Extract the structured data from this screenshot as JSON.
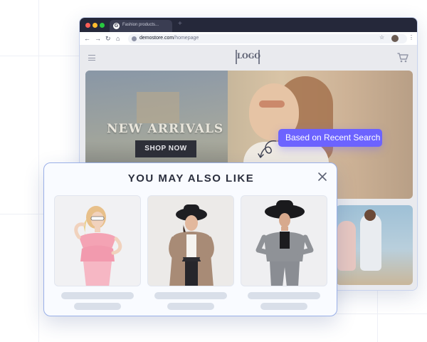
{
  "browser": {
    "tab_title": "Fashion products...",
    "tab_favicon_letter": "G",
    "new_tab_glyph": "+",
    "url_host": "demostore.com",
    "url_path": "/homepage",
    "icons": [
      "back-arrow-icon",
      "forward-arrow-icon",
      "reload-icon",
      "home-icon",
      "lock-icon",
      "star-icon",
      "profile-avatar",
      "more-vert-icon"
    ]
  },
  "store": {
    "logo_text": "LOGO",
    "hero_title": "NEW ARRIVALS",
    "hero_button": "SHOP NOW",
    "icons": [
      "hamburger-menu-icon",
      "cart-icon"
    ]
  },
  "tag": {
    "label": "Based on Recent Search",
    "color": "#6c63ff"
  },
  "modal": {
    "title": "YOU MAY ALSO LIKE",
    "close_icon": "close-icon",
    "border_color": "#9ab0e8",
    "products": [
      {
        "name": "product-pink-dress",
        "image": "woman in pink ruffle top with white sunglasses"
      },
      {
        "name": "product-trench-coat",
        "image": "woman in beige trench coat and black hat"
      },
      {
        "name": "product-grey-suit",
        "image": "woman in grey plaid suit and wide black hat"
      }
    ]
  }
}
